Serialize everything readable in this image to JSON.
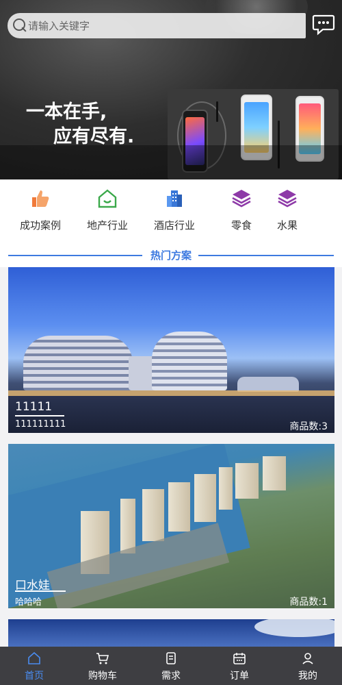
{
  "search": {
    "placeholder": "请输入关键字"
  },
  "banner": {
    "slogan_line1": "一本在手,",
    "slogan_line2": "应有尽有."
  },
  "categories": [
    {
      "label": "成功案例",
      "icon": "thumbs-up-icon",
      "color": "#f07a3a"
    },
    {
      "label": "地产行业",
      "icon": "house-icon",
      "color": "#3aa84a"
    },
    {
      "label": "酒店行业",
      "icon": "building-icon",
      "color": "#3a78d8"
    },
    {
      "label": "零食",
      "icon": "layers-icon",
      "color": "#8e3aa8"
    },
    {
      "label": "水果",
      "icon": "layers-icon",
      "color": "#8e3aa8"
    }
  ],
  "section": {
    "title": "热门方案"
  },
  "cards": [
    {
      "name": "11111",
      "subtitle": "111111111",
      "count_label": "商品数:",
      "count": "3"
    },
    {
      "name": "口水娃",
      "subtitle": "哈哈哈",
      "count_label": "商品数:",
      "count": "1"
    }
  ],
  "tabbar": [
    {
      "label": "首页",
      "icon": "home-icon",
      "active": true
    },
    {
      "label": "购物车",
      "icon": "cart-icon",
      "active": false
    },
    {
      "label": "需求",
      "icon": "document-icon",
      "active": false
    },
    {
      "label": "订单",
      "icon": "calendar-icon",
      "active": false
    },
    {
      "label": "我的",
      "icon": "user-icon",
      "active": false
    }
  ],
  "colors": {
    "accent": "#3d7ae0",
    "tab_active": "#4a8cf0",
    "tab_bg": "#3e3e42"
  }
}
